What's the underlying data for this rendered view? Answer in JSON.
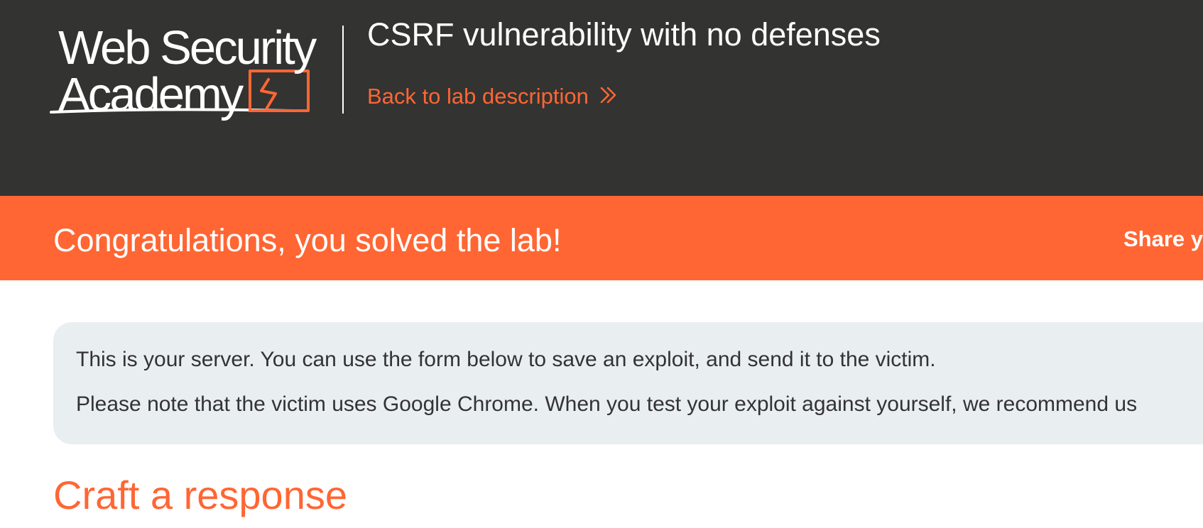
{
  "header": {
    "logo": {
      "line1": "Web Security",
      "line2": "Academy",
      "icon": "lightning-bolt-icon"
    },
    "lab_title": "CSRF vulnerability with no defenses",
    "back_link_label": "Back to lab description",
    "back_link_icon": "double-chevron-right-icon"
  },
  "banner": {
    "message": "Congratulations, you solved the lab!",
    "share_label": "Share y"
  },
  "info": {
    "line1": "This is your server. You can use the form below to save an exploit, and send it to the victim.",
    "line2": "Please note that the victim uses Google Chrome. When you test your exploit against yourself, we recommend us"
  },
  "main": {
    "heading": "Craft a response"
  },
  "colors": {
    "header_bg": "#333332",
    "accent": "#ff6633",
    "info_bg": "#e9eef1",
    "text": "#333333"
  }
}
